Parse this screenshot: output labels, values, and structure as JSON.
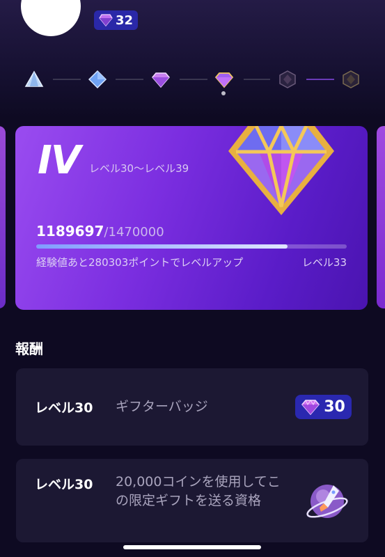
{
  "profile": {
    "level_badge": "32"
  },
  "tier_track": {
    "nodes": [
      "tier-1",
      "tier-2",
      "tier-3",
      "tier-4",
      "tier-5",
      "tier-6"
    ],
    "current_index": 3
  },
  "tier_card": {
    "roman": "IV",
    "range": "レベル30〜レベル39",
    "xp_current": "1189697",
    "xp_total": "/1470000",
    "progress": 0.81,
    "hint": "経験値あと280303ポイントでレベルアップ",
    "next_level": "レベル33"
  },
  "rewards": {
    "title": "報酬",
    "items": [
      {
        "level": "レベル30",
        "desc": "ギフターバッジ",
        "badge": "30"
      },
      {
        "level": "レベル30",
        "desc": "20,000コインを使用してこの限定ギフトを送る資格"
      }
    ]
  },
  "colors": {
    "accent": "#2a28b0",
    "card": "#7b2ee0",
    "background": "#0e0a22"
  }
}
